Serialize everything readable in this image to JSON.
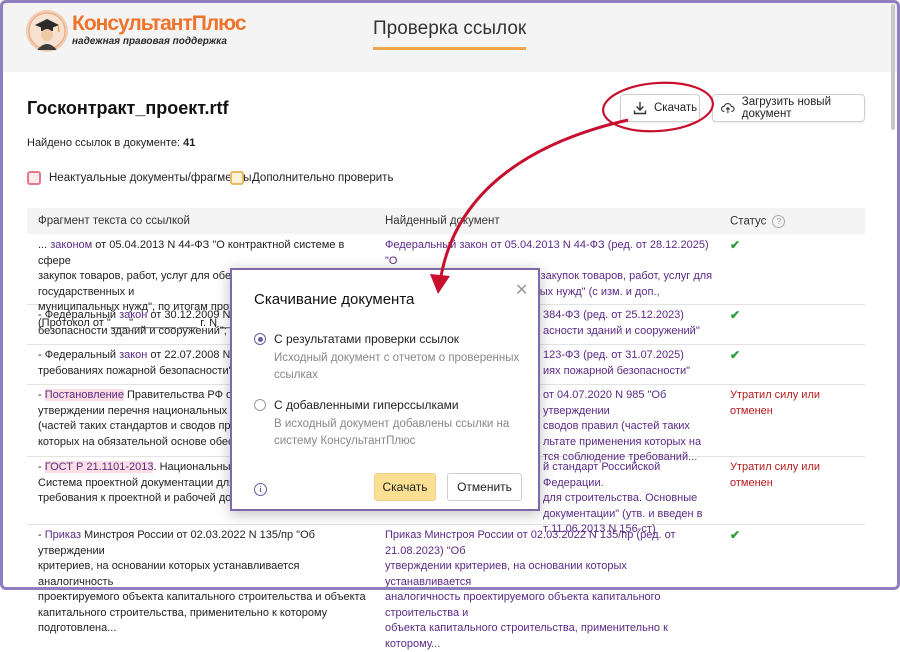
{
  "header": {
    "logo_name": "КонсультантПлюс",
    "logo_tagline": "надежная правовая поддержка",
    "page_title": "Проверка ссылок"
  },
  "document": {
    "name": "Госконтракт_проект.rtf",
    "found_label": "Найдено ссылок в документе:",
    "found_count": "41"
  },
  "toolbar": {
    "download_label": "Скачать",
    "upload_label": "Загрузить новый документ"
  },
  "legend": {
    "outdated": "Неактуальные документы/фрагменты",
    "check_more": "Дополнительно проверить"
  },
  "table": {
    "headers": [
      "Фрагмент текста со ссылкой",
      "Найденный документ",
      "Статус"
    ],
    "rows": [
      {
        "fragment_lines": [
          "... законом от 05.04.2013 N 44-ФЗ \"О контрактной системе в сфере",
          "закупок товаров, работ, услуг для обеспечения государственных и",
          "муниципальных нужд\", по итогам проведе",
          "(Протокол от \"___\"_______ ___ г. N ___), закл"
        ],
        "found_lines": [
          "Федеральный закон от 05.04.2013 N 44-ФЗ (ред. от 28.12.2025) \"О",
          "контрактной системе в сфере закупок товаров, работ, услуг для",
          "ципальных нужд\" (с изм. и доп.,"
        ],
        "status": "✔"
      },
      {
        "fragment_lines": [
          "- Федеральный закон от 30.12.2009 N 384-Ф",
          "безопасности зданий и сооружений\";"
        ],
        "found_lines": [
          "384-ФЗ (ред. от 25.12.2023)",
          "асности зданий и сооружений\""
        ],
        "status": "✔"
      },
      {
        "fragment_lines": [
          "- Федеральный закон от 22.07.2008 № 123-",
          "требованиях пожарной безопасности\";"
        ],
        "found_lines": [
          "123-ФЗ (ред. от 31.07.2025)",
          "иях пожарной безопасности\""
        ],
        "status": "✔"
      },
      {
        "fragment_lines": [
          "- Постановление Правительства РФ от 04.0",
          "утверждении перечня национальных станд",
          "(частей таких стандартов и сводов правил)",
          "которых на обязательной основе обеспечи"
        ],
        "found_lines": [
          "от 04.07.2020 N 985 \"Об утверждении",
          "сводов правил (частей таких",
          "льтате применения которых на",
          "тся соблюдение требований..."
        ],
        "status": "Утратил силу или отменен"
      },
      {
        "fragment_lines": [
          "- ГОСТ Р 21.1101-2013. Национальный стан",
          "Система проектной документации для стро",
          "требования к проектной и рабочей докум"
        ],
        "found_lines": [
          "й стандарт Российской Федерации.",
          "для строительства. Основные",
          "документации\" (утв. и введен в",
          "т 11.06.2013 N 156-ст)"
        ],
        "status": "Утратил силу или отменен"
      },
      {
        "fragment_lines": [
          "- Приказ Минстроя России от 02.03.2022 N 135/пр \"Об утверждении",
          "критериев, на основании которых устанавливается аналогичность",
          "проектируемого объекта капитального строительства и объекта",
          "капитального строительства, применительно к которому подготовлена..."
        ],
        "found_lines": [
          "Приказ Минстроя России от 02.03.2022 N 135/пр (ред. от 21.08.2023) \"Об",
          "утверждении критериев, на основании которых устанавливается",
          "аналогичность проектируемого объекта капитального строительства и",
          "объекта капитального строительства, применительно к которому..."
        ],
        "status": "✔"
      }
    ],
    "link_words": {
      "law": "законом",
      "law2": "закон",
      "decree": "Постановление",
      "gost": "ГОСТ Р 21.1101-2013",
      "order": "Приказ"
    }
  },
  "modal": {
    "title": "Скачивание документа",
    "close": "✕",
    "option1_label": "С результатами проверки ссылок",
    "option1_desc": "Исходный документ с отчетом о проверенных ссылках",
    "option2_label": "С добавленными гиперссылками",
    "option2_desc": "В исходный документ добавлены ссылки на систему КонсультантПлюс",
    "info": "i",
    "download_label": "Скачать",
    "cancel_label": "Отменить"
  },
  "colors": {
    "accent": "#f0a44b",
    "link": "#5b2a86",
    "ok": "#2e9a3a",
    "invalid": "#b71c1c",
    "annotation": "#c8102e",
    "frame": "#8e7fbf"
  }
}
